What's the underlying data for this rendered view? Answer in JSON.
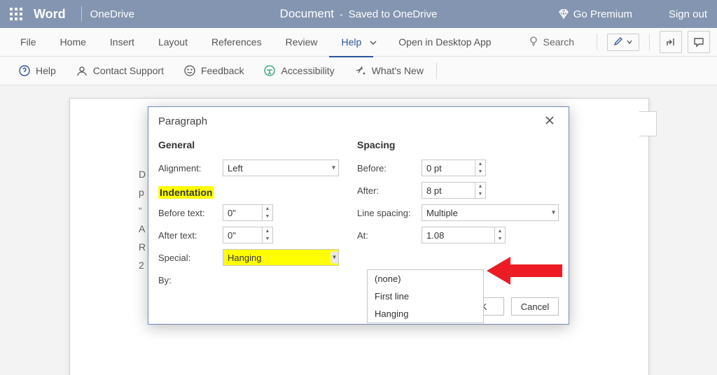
{
  "titlebar": {
    "app": "Word",
    "location": "OneDrive",
    "document": "Document",
    "dash": "-",
    "saved": "Saved to OneDrive",
    "premium": "Go Premium",
    "signout": "Sign out"
  },
  "ribbon": {
    "tabs": [
      "File",
      "Home",
      "Insert",
      "Layout",
      "References",
      "Review",
      "Help"
    ],
    "open_desktop": "Open in Desktop App",
    "search": "Search"
  },
  "subribbon": {
    "help": "Help",
    "contact": "Contact Support",
    "feedback": "Feedback",
    "accessibility": "Accessibility",
    "whatsnew": "What's New"
  },
  "page_lines": [
    "D",
    "p",
    " ",
    "“",
    "A",
    " ",
    "R",
    "2"
  ],
  "dialog": {
    "title": "Paragraph",
    "general": "General",
    "alignment_label": "Alignment:",
    "alignment_value": "Left",
    "indentation": "Indentation",
    "before_text": "Before text:",
    "before_text_val": "0\"",
    "after_text": "After text:",
    "after_text_val": "0\"",
    "special": "Special:",
    "special_val": "Hanging",
    "by": "By:",
    "spacing": "Spacing",
    "before": "Before:",
    "before_val": "0 pt",
    "after": "After:",
    "after_val": "8 pt",
    "line_spacing": "Line spacing:",
    "line_spacing_val": "Multiple",
    "at": "At:",
    "at_val": "1.08",
    "options": [
      "(none)",
      "First line",
      "Hanging"
    ],
    "ok": "OK",
    "cancel": "Cancel"
  }
}
